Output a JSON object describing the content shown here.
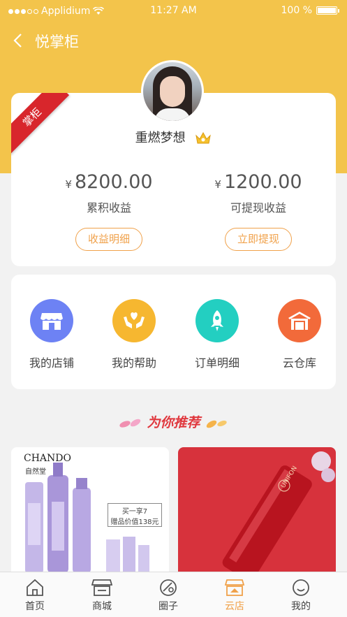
{
  "status_bar": {
    "carrier": "Applidium",
    "time": "11:27 AM",
    "battery": "100 %"
  },
  "nav": {
    "title": "悦掌柜"
  },
  "profile": {
    "badge": "掌柜",
    "username": "重燃梦想",
    "total_income": {
      "currency": "¥",
      "amount": "8200.00",
      "label": "累积收益",
      "button": "收益明细"
    },
    "withdrawable": {
      "currency": "¥",
      "amount": "1200.00",
      "label": "可提现收益",
      "button": "立即提现"
    }
  },
  "menu": [
    {
      "label": "我的店铺",
      "icon": "store-icon",
      "color": "#6d82f4"
    },
    {
      "label": "我的帮助",
      "icon": "heart-hands-icon",
      "color": "#f6b730"
    },
    {
      "label": "订单明细",
      "icon": "rocket-icon",
      "color": "#23cfc1"
    },
    {
      "label": "云仓库",
      "icon": "warehouse-icon",
      "color": "#f26a3a"
    }
  ],
  "recommend": {
    "title": "为你推荐"
  },
  "products": [
    {
      "brand": "CHANDO",
      "brand_sub": "自然堂",
      "promo_line1": "买一享7",
      "promo_line2": "赠品价值138元"
    },
    {
      "brand": "UNIFON"
    }
  ],
  "tabbar": [
    {
      "label": "首页",
      "icon": "home-icon",
      "active": false
    },
    {
      "label": "商城",
      "icon": "mall-icon",
      "active": false
    },
    {
      "label": "圈子",
      "icon": "circle-icon",
      "active": false
    },
    {
      "label": "云店",
      "icon": "cloud-store-icon",
      "active": true
    },
    {
      "label": "我的",
      "icon": "smile-icon",
      "active": false
    }
  ],
  "colors": {
    "accent": "#f3c44b",
    "button": "#f0a14a",
    "ribbon": "#d8262c"
  }
}
